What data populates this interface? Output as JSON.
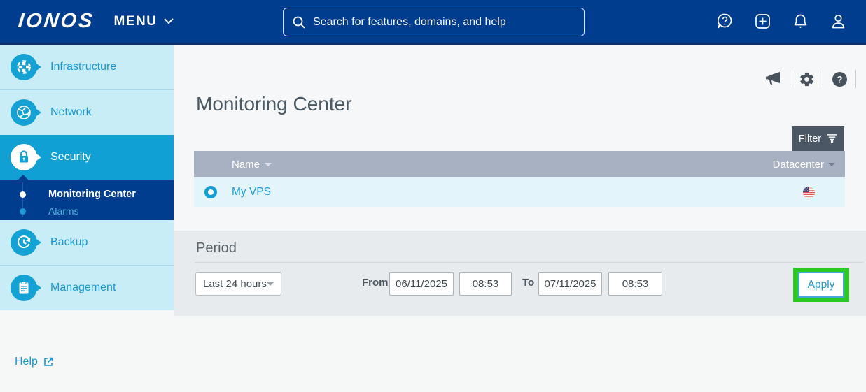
{
  "colors": {
    "brand_blue": "#003d8f",
    "accent_blue": "#14a1d4",
    "link_blue": "#1796d1",
    "highlight_green": "#2bc922",
    "table_header": "#a7b1c2",
    "row_bg": "#e3f5fb"
  },
  "topbar": {
    "logo": "IONOS",
    "menu_label": "MENU",
    "search_placeholder": "Search for features, domains, and help",
    "icons": [
      "help-chat",
      "add",
      "notifications",
      "account"
    ]
  },
  "sidebar": {
    "items": [
      {
        "label": "Infrastructure",
        "icon": "infrastructure",
        "active": false
      },
      {
        "label": "Network",
        "icon": "network",
        "active": false
      },
      {
        "label": "Security",
        "icon": "security-lock",
        "active": true
      },
      {
        "label": "Backup",
        "icon": "backup-restore",
        "active": false
      },
      {
        "label": "Management",
        "icon": "clipboard",
        "active": false
      }
    ],
    "security_submenu": [
      {
        "label": "Monitoring Center",
        "active": true
      },
      {
        "label": "Alarms",
        "active": false
      }
    ]
  },
  "page": {
    "title": "Monitoring Center",
    "header_icons": [
      "announcements",
      "settings",
      "help"
    ],
    "filter_label": "Filter"
  },
  "table": {
    "columns": [
      {
        "label": "Name"
      },
      {
        "label": "Datacenter"
      }
    ],
    "rows": [
      {
        "name": "My VPS",
        "datacenter": "us-flag",
        "selected": true
      }
    ]
  },
  "period": {
    "title": "Period",
    "range_value": "Last 24 hours",
    "from_label": "From",
    "from_date": "06/11/2025",
    "from_time": "08:53",
    "to_label": "To",
    "to_date": "07/11/2025",
    "to_time": "08:53",
    "apply_label": "Apply"
  },
  "footer": {
    "help_label": "Help"
  }
}
